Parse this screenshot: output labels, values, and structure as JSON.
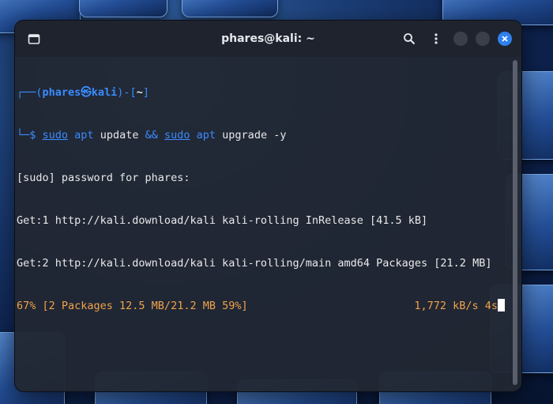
{
  "window": {
    "title": "phares@kali: ~"
  },
  "icons": {
    "new_tab": "new-tab-icon",
    "search": "search-icon",
    "menu": "kebab-menu-icon",
    "minimize": "minimize-icon",
    "maximize": "maximize-icon",
    "close": "close-icon"
  },
  "colors": {
    "prompt_blue": "#3a8cff",
    "progress_orange": "#f0a24a",
    "close_button": "#2f80ed"
  },
  "prompt": {
    "bracket_open": "┌──(",
    "user_host": "phares㉿kali",
    "bracket_mid": ")-[",
    "dir": "~",
    "bracket_close": "]",
    "prefix": "└─$ "
  },
  "command": {
    "sudo1": "sudo",
    "apt1": "apt",
    "update": " update ",
    "and": "&&",
    "sudo2": "sudo",
    "apt2": "apt",
    "rest": " upgrade -y"
  },
  "output": {
    "line1": "[sudo] password for phares:",
    "line2": "Get:1 http://kali.download/kali kali-rolling InRelease [41.5 kB]",
    "line3": "Get:2 http://kali.download/kali kali-rolling/main amd64 Packages [21.2 MB]",
    "progress_left": "67% [2 Packages 12.5 MB/21.2 MB 59%]",
    "progress_right": "1,772 kB/s 4s"
  }
}
